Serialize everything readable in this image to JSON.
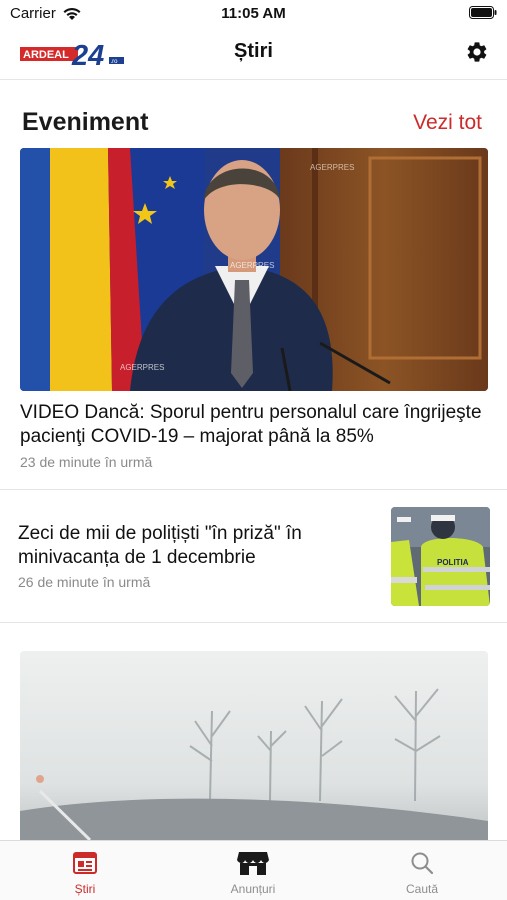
{
  "status": {
    "carrier": "Carrier",
    "time": "11:05 AM"
  },
  "header": {
    "logo_text": "ARDEAL 24.ro",
    "title": "Știri"
  },
  "section": {
    "title": "Eveniment",
    "see_all": "Vezi tot"
  },
  "articles": [
    {
      "title": "VIDEO Dancă: Sporul pentru personalul care îngrijeşte pacienţi COVID-19 – majorat până la 85%",
      "time": "23 de minute în urmă",
      "image_alt": "AGERPRES"
    },
    {
      "title": "Zeci de mii de polițiști \"în priză\" în minivacanța de 1 decembrie",
      "time": "26 de minute în urmă"
    }
  ],
  "tabs": [
    {
      "label": "Știri",
      "icon": "news-icon",
      "active": true
    },
    {
      "label": "Anunțuri",
      "icon": "store-icon",
      "active": false
    },
    {
      "label": "Caută",
      "icon": "search-icon",
      "active": false
    }
  ],
  "colors": {
    "accent": "#cc2b2b",
    "muted": "#8a8a8a"
  }
}
